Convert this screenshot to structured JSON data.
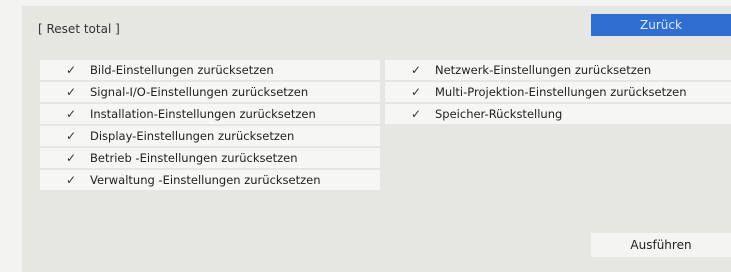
{
  "dialog": {
    "title": "[ Reset total ]",
    "back_button": "Zurück",
    "execute_button": "Ausführen"
  },
  "left_items": [
    {
      "label": "Bild-Einstellungen zurücksetzen",
      "checked": true
    },
    {
      "label": "Signal-I/O-Einstellungen zurücksetzen",
      "checked": true
    },
    {
      "label": "Installation-Einstellungen zurücksetzen",
      "checked": true
    },
    {
      "label": "Display-Einstellungen zurücksetzen",
      "checked": true
    },
    {
      "label": "Betrieb -Einstellungen zurücksetzen",
      "checked": true
    },
    {
      "label": "Verwaltung -Einstellungen zurücksetzen",
      "checked": true
    }
  ],
  "right_items": [
    {
      "label": "Netzwerk-Einstellungen zurücksetzen",
      "checked": true
    },
    {
      "label": "Multi-Projektion-Einstellungen zurücksetzen",
      "checked": true
    },
    {
      "label": "Speicher-Rückstellung",
      "checked": true
    }
  ],
  "icons": {
    "check": "✓"
  },
  "colors": {
    "accent": "#2e6fd1",
    "panel": "#e6e6e3",
    "item_bg": "#f6f6f4"
  }
}
